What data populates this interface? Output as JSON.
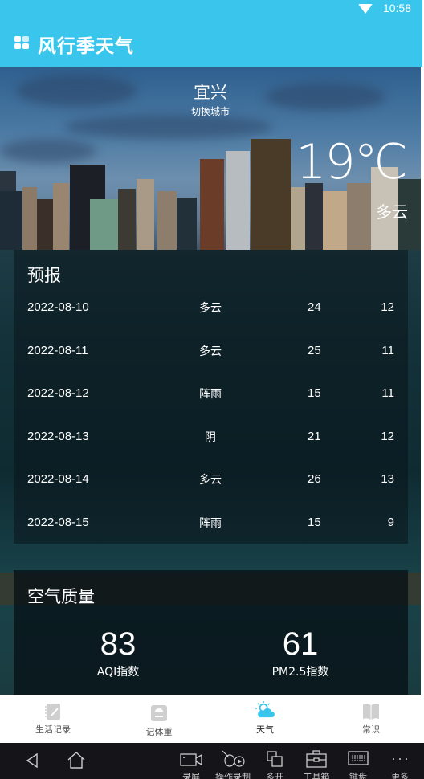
{
  "status_bar": {
    "time": "10:58",
    "wifi_icon": "wifi-icon"
  },
  "app_bar": {
    "title": "风行季天气",
    "logo_icon": "grid-icon"
  },
  "current": {
    "city": "宜兴",
    "switch_city_label": "切换城市",
    "temperature": "19℃",
    "condition": "多云"
  },
  "forecast": {
    "title": "预报",
    "rows": [
      {
        "date": "2022-08-10",
        "condition": "多云",
        "high": "24",
        "low": "12"
      },
      {
        "date": "2022-08-11",
        "condition": "多云",
        "high": "25",
        "low": "11"
      },
      {
        "date": "2022-08-12",
        "condition": "阵雨",
        "high": "15",
        "low": "11"
      },
      {
        "date": "2022-08-13",
        "condition": "阴",
        "high": "21",
        "low": "12"
      },
      {
        "date": "2022-08-14",
        "condition": "多云",
        "high": "26",
        "low": "13"
      },
      {
        "date": "2022-08-15",
        "condition": "阵雨",
        "high": "15",
        "low": "9"
      }
    ]
  },
  "air_quality": {
    "title": "空气质量",
    "aqi": {
      "value": "83",
      "label": "AQI指数"
    },
    "pm25": {
      "value": "61",
      "label": "PM2.5指数"
    }
  },
  "tabs": [
    {
      "label": "生活记录",
      "icon": "notebook-icon",
      "active": false
    },
    {
      "label": "记体重",
      "icon": "scale-icon",
      "active": false
    },
    {
      "label": "天气",
      "icon": "weather-icon",
      "active": true
    },
    {
      "label": "常识",
      "icon": "book-icon",
      "active": false
    }
  ],
  "accent_color": "#3ac6ec",
  "system_nav": {
    "back_icon": "back-icon",
    "home_icon": "home-icon",
    "tools": [
      {
        "label": "录屏",
        "icon": "record-screen-icon"
      },
      {
        "label": "操作录制",
        "icon": "macro-record-icon"
      },
      {
        "label": "多开",
        "icon": "multi-instance-icon"
      },
      {
        "label": "工具箱",
        "icon": "toolbox-icon"
      },
      {
        "label": "键盘",
        "icon": "keyboard-icon"
      },
      {
        "label": "更多",
        "icon": "more-icon"
      }
    ]
  }
}
